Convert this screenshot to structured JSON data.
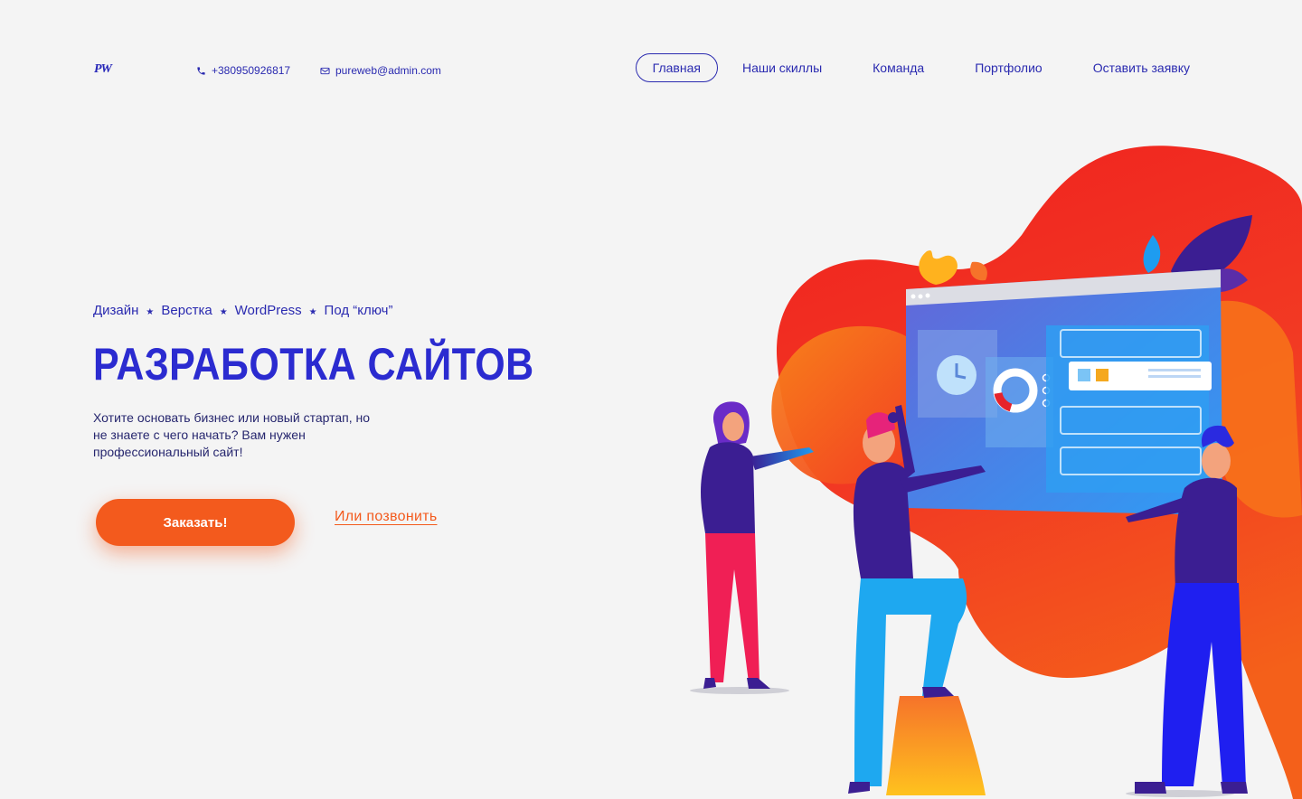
{
  "header": {
    "logo": "PW",
    "phone": "+380950926817",
    "email": "pureweb@admin.com",
    "phone_icon": "phone-icon",
    "email_icon": "envelope-icon"
  },
  "nav": {
    "items": [
      {
        "label": "Главная",
        "active": true
      },
      {
        "label": "Наши скиллы",
        "active": false
      },
      {
        "label": "Команда",
        "active": false
      },
      {
        "label": "Портфолио",
        "active": false
      },
      {
        "label": "Оставить заявку",
        "active": false
      }
    ]
  },
  "hero": {
    "tags": [
      "Дизайн",
      "Верстка",
      "WordPress",
      "Под “ключ”"
    ],
    "tag_separator_icon": "star-icon",
    "title": "РАЗРАБОТКА САЙТОВ",
    "subtitle": "Хотите основать бизнес или новый стартап, но не знаете с чего начать? Вам нужен профессиональный сайт!",
    "order_button": "Заказать!",
    "call_link": "Или позвонить",
    "illustration": "team-building-website-illustration"
  },
  "colors": {
    "background": "#f4f4f4",
    "primary": "#2b2bd0",
    "accent": "#f35a1d"
  }
}
